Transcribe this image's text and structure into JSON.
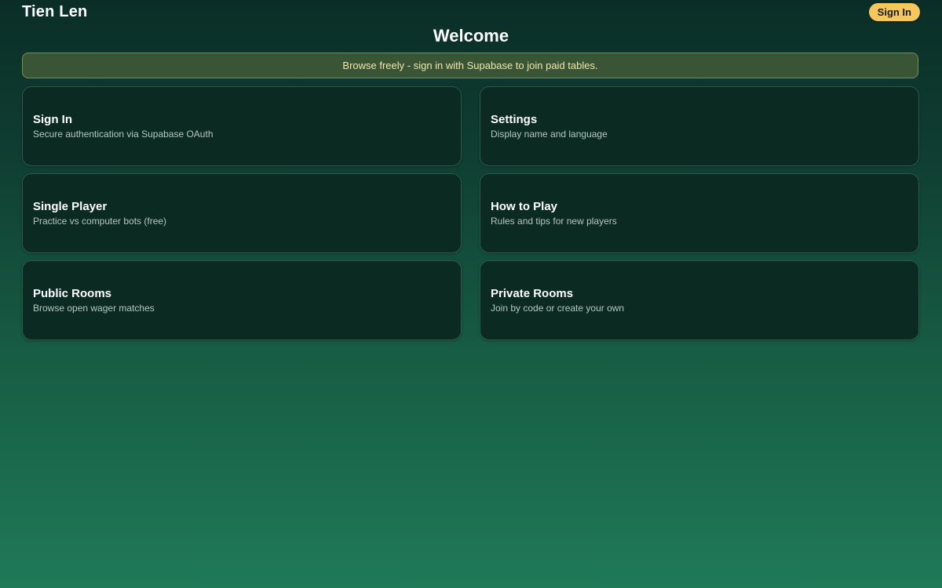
{
  "header": {
    "brand": "Tien Len",
    "signin_label": "Sign In"
  },
  "page": {
    "title": "Welcome",
    "notice": "Browse freely - sign in with Supabase to join paid tables."
  },
  "cards": [
    {
      "title": "Sign In",
      "desc": "Secure authentication via Supabase OAuth"
    },
    {
      "title": "Settings",
      "desc": "Display name and language"
    },
    {
      "title": "Single Player",
      "desc": "Practice vs computer bots (free)"
    },
    {
      "title": "How to Play",
      "desc": "Rules and tips for new players"
    },
    {
      "title": "Public Rooms",
      "desc": "Browse open wager matches"
    },
    {
      "title": "Private Rooms",
      "desc": "Join by code or create your own"
    }
  ],
  "colors": {
    "accent": "#f4c75f",
    "card_bg": "#0b2a22",
    "notice_bg": "#3a5535",
    "notice_text": "#f3e6a7"
  }
}
